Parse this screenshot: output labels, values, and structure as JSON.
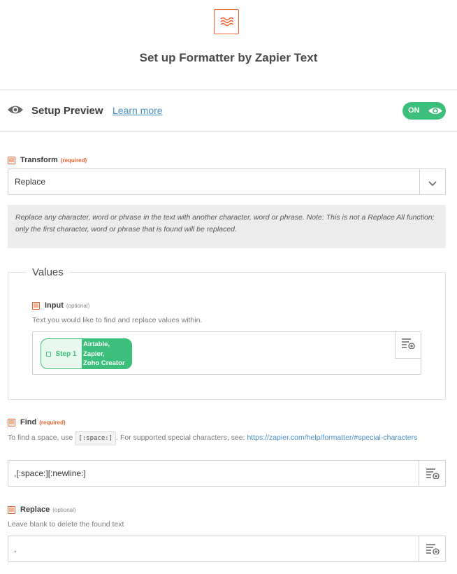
{
  "header": {
    "title": "Set up Formatter by Zapier Text",
    "logo_icon": "formatter-icon"
  },
  "preview": {
    "label": "Setup Preview",
    "learn_more": "Learn more",
    "toggle_label": "ON",
    "toggle_color": "#3cbf7b"
  },
  "transform": {
    "label": "Transform",
    "badge": "(required)",
    "value": "Replace",
    "help": "Replace any character, word or phrase in the text with another character, word or phrase. Note: This is not a Replace All function; only the first character, word or phrase that is found will be replaced."
  },
  "values": {
    "legend": "Values",
    "input": {
      "label": "Input",
      "badge": "(optional)",
      "description": "Text you would like to find and replace values within.",
      "pill": {
        "step": "Step 1",
        "lines": [
          "Airtable,",
          "Zapier,",
          "Zoho Creator"
        ]
      }
    }
  },
  "find": {
    "label": "Find",
    "badge": "(required)",
    "hint_prefix": "To find a space, use",
    "hint_code": "[:space:]",
    "hint_middle": ". For supported special characters, see:",
    "hint_link": "https://zapier.com/help/formatter/#special-characters",
    "value": ",[:space:][:newline:]"
  },
  "replace": {
    "label": "Replace",
    "badge": "(optional)",
    "description": "Leave blank to delete the found text",
    "value": ","
  },
  "colors": {
    "accent": "#f0622d",
    "link": "#4a90c2",
    "success": "#3cbf7b"
  }
}
